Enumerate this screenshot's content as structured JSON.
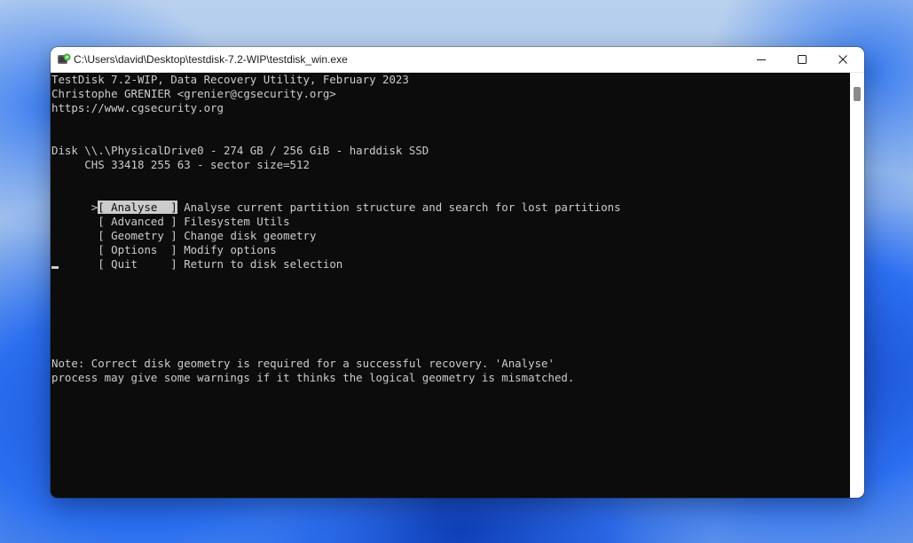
{
  "window": {
    "title": "C:\\Users\\david\\Desktop\\testdisk-7.2-WIP\\testdisk_win.exe"
  },
  "console": {
    "header": [
      "TestDisk 7.2-WIP, Data Recovery Utility, February 2023",
      "Christophe GRENIER <grenier@cgsecurity.org>",
      "https://www.cgsecurity.org"
    ],
    "disk_line": "Disk \\\\.\\PhysicalDrive0 - 274 GB / 256 GiB - harddisk SSD",
    "chs_line": "     CHS 33418 255 63 - sector size=512",
    "menu": [
      {
        "prefix": ">",
        "label": "[ Analyse  ]",
        "desc": " Analyse current partition structure and search for lost partitions",
        "selected": true
      },
      {
        "prefix": " ",
        "label": "[ Advanced ]",
        "desc": " Filesystem Utils",
        "selected": false
      },
      {
        "prefix": " ",
        "label": "[ Geometry ]",
        "desc": " Change disk geometry",
        "selected": false
      },
      {
        "prefix": " ",
        "label": "[ Options  ]",
        "desc": " Modify options",
        "selected": false
      },
      {
        "prefix": " ",
        "label": "[ Quit     ]",
        "desc": " Return to disk selection",
        "selected": false
      }
    ],
    "note": [
      "Note: Correct disk geometry is required for a successful recovery. 'Analyse'",
      "process may give some warnings if it thinks the logical geometry is mismatched."
    ]
  },
  "colors": {
    "console_bg": "#0c0c0c",
    "console_fg": "#cccccc"
  },
  "icons": {
    "app": "testdisk-app-icon",
    "minimize": "minimize-icon",
    "maximize": "maximize-icon",
    "close": "close-icon"
  }
}
